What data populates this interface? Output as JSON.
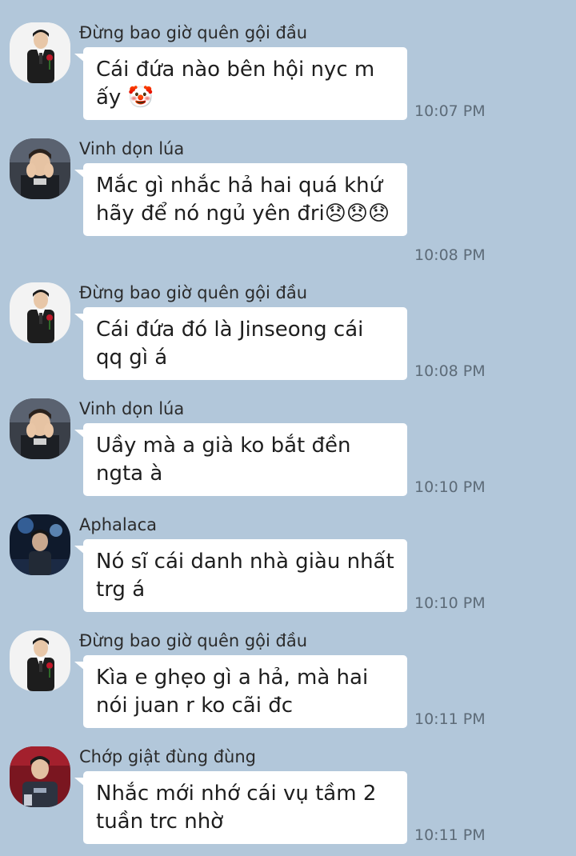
{
  "messages": [
    {
      "sender": "Đừng bao giờ quên gội đầu",
      "avatar": "man-in-suit-holding-rose-avatar",
      "text": "Cái đứa nào bên hội nyc m ấy 🤡",
      "time": "10:07 PM"
    },
    {
      "sender": "Vinh dọn lúa",
      "avatar": "man-covering-face-avatar",
      "text": "Mắc gì nhắc hả hai quá khứ hãy để nó ngủ yên đri😞😞😞",
      "time": "10:08 PM"
    },
    {
      "sender": "Đừng bao giờ quên gội đầu",
      "avatar": "man-in-suit-holding-rose-avatar",
      "text": "Cái đứa đó là Jinseong cái qq gì á",
      "time": "10:08 PM"
    },
    {
      "sender": "Vinh dọn lúa",
      "avatar": "man-covering-face-avatar",
      "text": "Uầy mà a già ko bắt đền ngta à",
      "time": "10:10 PM"
    },
    {
      "sender": "Aphalaca",
      "avatar": "player-on-stage-avatar",
      "text": "Nó sĩ cái danh nhà giàu nhất trg á",
      "time": "10:10 PM"
    },
    {
      "sender": "Đừng bao giờ quên gội đầu",
      "avatar": "man-in-suit-holding-rose-avatar",
      "text": "Kìa e ghẹo gì a hả, mà hai nói juan r ko cãi đc",
      "time": "10:11 PM"
    },
    {
      "sender": "Chớp giật đùng đùng",
      "avatar": "player-in-jersey-avatar",
      "text": "Nhắc mới nhớ cái vụ tầm 2 tuần trc nhờ",
      "time": "10:11 PM"
    }
  ],
  "colors": {
    "background": "#b2c7da",
    "bubble": "#ffffff",
    "time": "#5d6b78"
  }
}
